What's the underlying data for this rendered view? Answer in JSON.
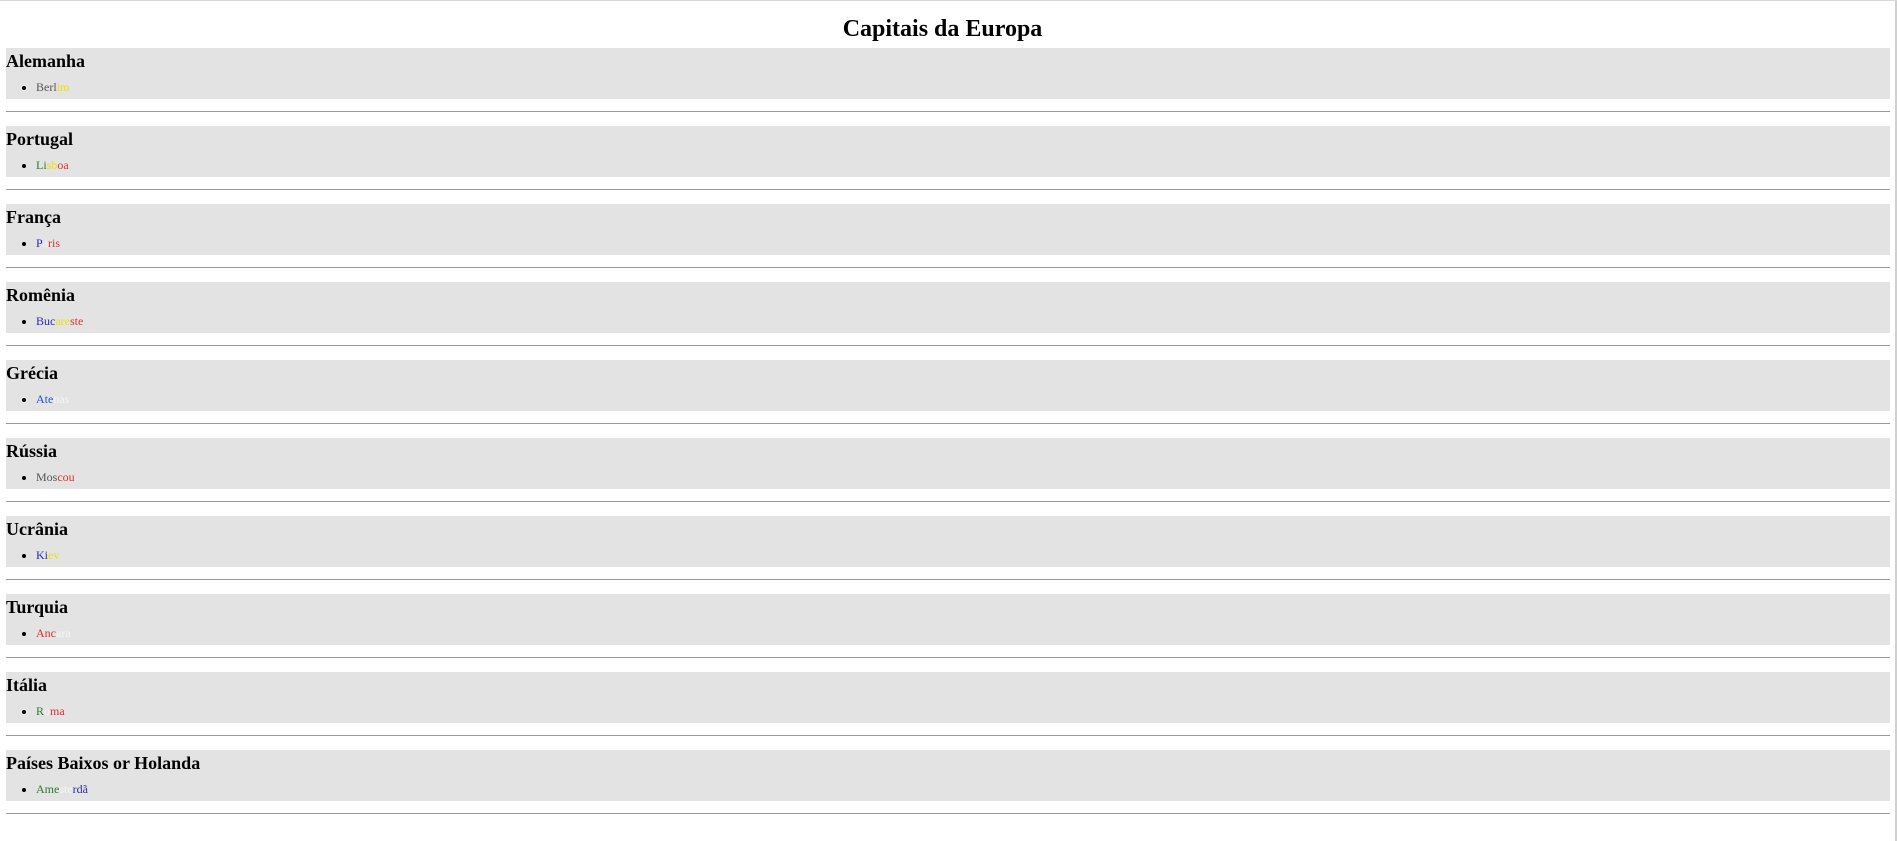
{
  "page": {
    "title": "Capitais da Europa"
  },
  "countries": [
    {
      "name": "Alemanha",
      "capital_parts": [
        {
          "text": "Berl",
          "color": "#555555"
        },
        {
          "text": "im",
          "color": "#f0e000"
        }
      ]
    },
    {
      "name": "Portugal",
      "capital_parts": [
        {
          "text": "Li",
          "color": "#2d7a2d"
        },
        {
          "text": "sb",
          "color": "#f0e000"
        },
        {
          "text": "oa",
          "color": "#e03030"
        }
      ]
    },
    {
      "name": "França",
      "capital_parts": [
        {
          "text": "P",
          "color": "#2a2aaa"
        },
        {
          "text": "a",
          "color": "#f5f5f5"
        },
        {
          "text": "ris",
          "color": "#e03030"
        }
      ]
    },
    {
      "name": "Romênia",
      "capital_parts": [
        {
          "text": "Buc",
          "color": "#2a2aaa"
        },
        {
          "text": "are",
          "color": "#f0e000"
        },
        {
          "text": "ste",
          "color": "#e03030"
        }
      ]
    },
    {
      "name": "Grécia",
      "capital_parts": [
        {
          "text": "Ate",
          "color": "#2a50c8"
        },
        {
          "text": "nas",
          "color": "#f5f5f5"
        }
      ]
    },
    {
      "name": "Rússia",
      "capital_parts": [
        {
          "text": "Mos",
          "color": "#555555"
        },
        {
          "text": "cou",
          "color": "#e03030"
        }
      ]
    },
    {
      "name": "Ucrânia",
      "capital_parts": [
        {
          "text": "Ki",
          "color": "#2a2aaa"
        },
        {
          "text": "ev",
          "color": "#f0e000"
        }
      ]
    },
    {
      "name": "Turquia",
      "capital_parts": [
        {
          "text": "Anc",
          "color": "#e03030"
        },
        {
          "text": "ara",
          "color": "#f5f5f5"
        }
      ]
    },
    {
      "name": "Itália",
      "capital_parts": [
        {
          "text": "R",
          "color": "#2d7a2d"
        },
        {
          "text": "o",
          "color": "#f5f5f5"
        },
        {
          "text": "ma",
          "color": "#e03030"
        }
      ]
    },
    {
      "name": "Países Baixos or Holanda",
      "capital_parts": [
        {
          "text": "Ame",
          "color": "#2d7a2d"
        },
        {
          "text": "ste",
          "color": "#f5f5f5"
        },
        {
          "text": "rdã",
          "color": "#2a2aaa"
        }
      ]
    }
  ]
}
